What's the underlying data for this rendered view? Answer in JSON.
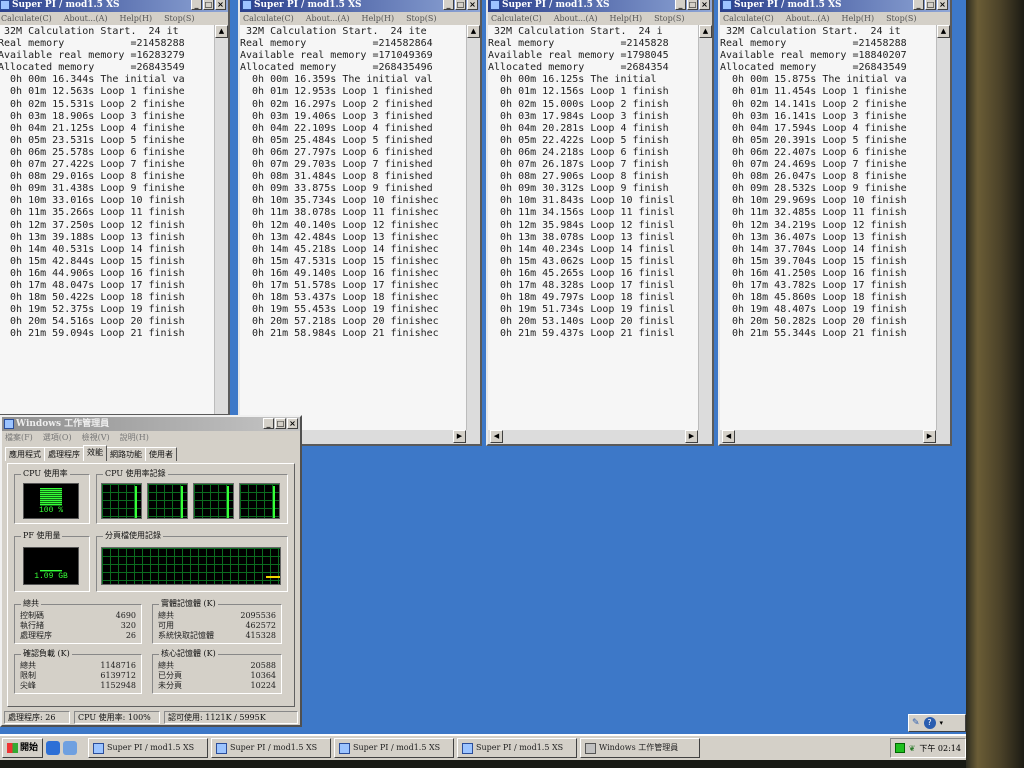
{
  "superpi_windows": [
    {
      "title": "Super PI / mod1.5 XS",
      "menu": [
        "Calculate(C)",
        "About...(A)",
        "Help(H)",
        "Stop(S)"
      ],
      "lines": [
        " 32M Calculation Start.  24 it",
        "Real memory           =21458288",
        "Available real memory =16283279",
        "Allocated memory      =26843549",
        "  0h 00m 16.344s The initial va",
        "  0h 01m 12.563s Loop 1 finishe",
        "  0h 02m 15.531s Loop 2 finishe",
        "  0h 03m 18.906s Loop 3 finishe",
        "  0h 04m 21.125s Loop 4 finishe",
        "  0h 05m 23.531s Loop 5 finishe",
        "  0h 06m 25.578s Loop 6 finishe",
        "  0h 07m 27.422s Loop 7 finishe",
        "  0h 08m 29.016s Loop 8 finishe",
        "  0h 09m 31.438s Loop 9 finishe",
        "  0h 10m 33.016s Loop 10 finish",
        "  0h 11m 35.266s Loop 11 finish",
        "  0h 12m 37.250s Loop 12 finish",
        "  0h 13m 39.188s Loop 13 finish",
        "  0h 14m 40.531s Loop 14 finish",
        "  0h 15m 42.844s Loop 15 finish",
        "  0h 16m 44.906s Loop 16 finish",
        "  0h 17m 48.047s Loop 17 finish",
        "  0h 18m 50.422s Loop 18 finish",
        "  0h 19m 52.375s Loop 19 finish",
        "  0h 20m 54.516s Loop 20 finish",
        "  0h 21m 59.094s Loop 21 finish"
      ]
    },
    {
      "title": "Super PI / mod1.5 XS",
      "menu": [
        "Calculate(C)",
        "About...(A)",
        "Help(H)",
        "Stop(S)"
      ],
      "lines": [
        " 32M Calculation Start.  24 ite",
        "Real memory           =214582864",
        "Available real memory =171049369",
        "Allocated memory      =268435496",
        "  0h 00m 16.359s The initial val",
        "  0h 01m 12.953s Loop 1 finished",
        "  0h 02m 16.297s Loop 2 finished",
        "  0h 03m 19.406s Loop 3 finished",
        "  0h 04m 22.109s Loop 4 finished",
        "  0h 05m 25.484s Loop 5 finished",
        "  0h 06m 27.797s Loop 6 finished",
        "  0h 07m 29.703s Loop 7 finished",
        "  0h 08m 31.484s Loop 8 finished",
        "  0h 09m 33.875s Loop 9 finished",
        "  0h 10m 35.734s Loop 10 finishec",
        "  0h 11m 38.078s Loop 11 finishec",
        "  0h 12m 40.140s Loop 12 finishec",
        "  0h 13m 42.484s Loop 13 finishec",
        "  0h 14m 45.218s Loop 14 finishec",
        "  0h 15m 47.531s Loop 15 finishec",
        "  0h 16m 49.140s Loop 16 finishec",
        "  0h 17m 51.578s Loop 17 finishec",
        "  0h 18m 53.437s Loop 18 finishec",
        "  0h 19m 55.453s Loop 19 finishec",
        "  0h 20m 57.218s Loop 20 finishec",
        "  0h 21m 58.984s Loop 21 finishec"
      ]
    },
    {
      "title": "Super PI / mod1.5 XS",
      "menu": [
        "Calculate(C)",
        "About...(A)",
        "Help(H)",
        "Stop(S)"
      ],
      "lines": [
        " 32M Calculation Start.  24 i",
        "Real memory           =2145828",
        "Available real memory =1798045",
        "Allocated memory      =2684354",
        "  0h 00m 16.125s The initial",
        "  0h 01m 12.156s Loop 1 finish",
        "  0h 02m 15.000s Loop 2 finish",
        "  0h 03m 17.984s Loop 3 finish",
        "  0h 04m 20.281s Loop 4 finish",
        "  0h 05m 22.422s Loop 5 finish",
        "  0h 06m 24.218s Loop 6 finish",
        "  0h 07m 26.187s Loop 7 finish",
        "  0h 08m 27.906s Loop 8 finish",
        "  0h 09m 30.312s Loop 9 finish",
        "  0h 10m 31.843s Loop 10 finisl",
        "  0h 11m 34.156s Loop 11 finisl",
        "  0h 12m 35.984s Loop 12 finisl",
        "  0h 13m 38.078s Loop 13 finisl",
        "  0h 14m 40.234s Loop 14 finisl",
        "  0h 15m 43.062s Loop 15 finisl",
        "  0h 16m 45.265s Loop 16 finisl",
        "  0h 17m 48.328s Loop 17 finisl",
        "  0h 18m 49.797s Loop 18 finisl",
        "  0h 19m 51.734s Loop 19 finisl",
        "  0h 20m 53.140s Loop 20 finisl",
        "  0h 21m 59.437s Loop 21 finisl"
      ]
    },
    {
      "title": "Super PI / mod1.5 XS",
      "menu": [
        "Calculate(C)",
        "About...(A)",
        "Help(H)",
        "Stop(S)"
      ],
      "lines": [
        " 32M Calculation Start.  24 it",
        "Real memory           =21458288",
        "Available real memory =18840207",
        "Allocated memory      =26843549",
        "  0h 00m 15.875s The initial va",
        "  0h 01m 11.454s Loop 1 finishe",
        "  0h 02m 14.141s Loop 2 finishe",
        "  0h 03m 16.141s Loop 3 finishe",
        "  0h 04m 17.594s Loop 4 finishe",
        "  0h 05m 20.391s Loop 5 finishe",
        "  0h 06m 22.407s Loop 6 finishe",
        "  0h 07m 24.469s Loop 7 finishe",
        "  0h 08m 26.047s Loop 8 finishe",
        "  0h 09m 28.532s Loop 9 finishe",
        "  0h 10m 29.969s Loop 10 finish",
        "  0h 11m 32.485s Loop 11 finish",
        "  0h 12m 34.219s Loop 12 finish",
        "  0h 13m 36.407s Loop 13 finish",
        "  0h 14m 37.704s Loop 14 finish",
        "  0h 15m 39.704s Loop 15 finish",
        "  0h 16m 41.250s Loop 16 finish",
        "  0h 17m 43.782s Loop 17 finish",
        "  0h 18m 45.860s Loop 18 finish",
        "  0h 19m 48.407s Loop 19 finish",
        "  0h 20m 50.282s Loop 20 finish",
        "  0h 21m 55.344s Loop 21 finish"
      ]
    }
  ],
  "task_manager": {
    "title": "Windows 工作管理員",
    "menu": [
      "檔案(F)",
      "選項(O)",
      "檢視(V)",
      "說明(H)"
    ],
    "tabs": [
      "應用程式",
      "處理程序",
      "效能",
      "網路功能",
      "使用者"
    ],
    "active_tab": "效能",
    "cpu_usage_label": "CPU 使用率",
    "cpu_usage_value": "100 %",
    "cpu_history_label": "CPU 使用率記錄",
    "pf_usage_label": "PF 使用量",
    "pf_usage_value": "1.09 GB",
    "pf_history_label": "分頁檔使用記錄",
    "totals": {
      "label": "總共",
      "rows": [
        {
          "k": "控制碼",
          "v": "4690"
        },
        {
          "k": "執行緒",
          "v": "320"
        },
        {
          "k": "處理程序",
          "v": "26"
        }
      ]
    },
    "physical_memory": {
      "label": "實體記憶體 (K)",
      "rows": [
        {
          "k": "總共",
          "v": "2095536"
        },
        {
          "k": "可用",
          "v": "462572"
        },
        {
          "k": "系統快取記憶體",
          "v": "415328"
        }
      ]
    },
    "commit_charge": {
      "label": "確認負載 (K)",
      "rows": [
        {
          "k": "總共",
          "v": "1148716"
        },
        {
          "k": "限制",
          "v": "6139712"
        },
        {
          "k": "尖峰",
          "v": "1152948"
        }
      ]
    },
    "kernel_memory": {
      "label": "核心記憶體 (K)",
      "rows": [
        {
          "k": "總共",
          "v": "20588"
        },
        {
          "k": "已分頁",
          "v": "10364"
        },
        {
          "k": "未分頁",
          "v": "10224"
        }
      ]
    },
    "status": {
      "processes": "處理程序: 26",
      "cpu": "CPU 使用率: 100%",
      "commit": "認可使用: 1121K / 5995K"
    }
  },
  "taskbar": {
    "start_label": "開始",
    "buttons": [
      "Super PI / mod1.5 XS",
      "Super PI / mod1.5 XS",
      "Super PI / mod1.5 XS",
      "Super PI / mod1.5 XS",
      "Windows 工作管理員"
    ],
    "clock": "下午 02:14"
  },
  "colors": {
    "desktop": "#3d78c8",
    "meter_green": "#37ff37"
  }
}
